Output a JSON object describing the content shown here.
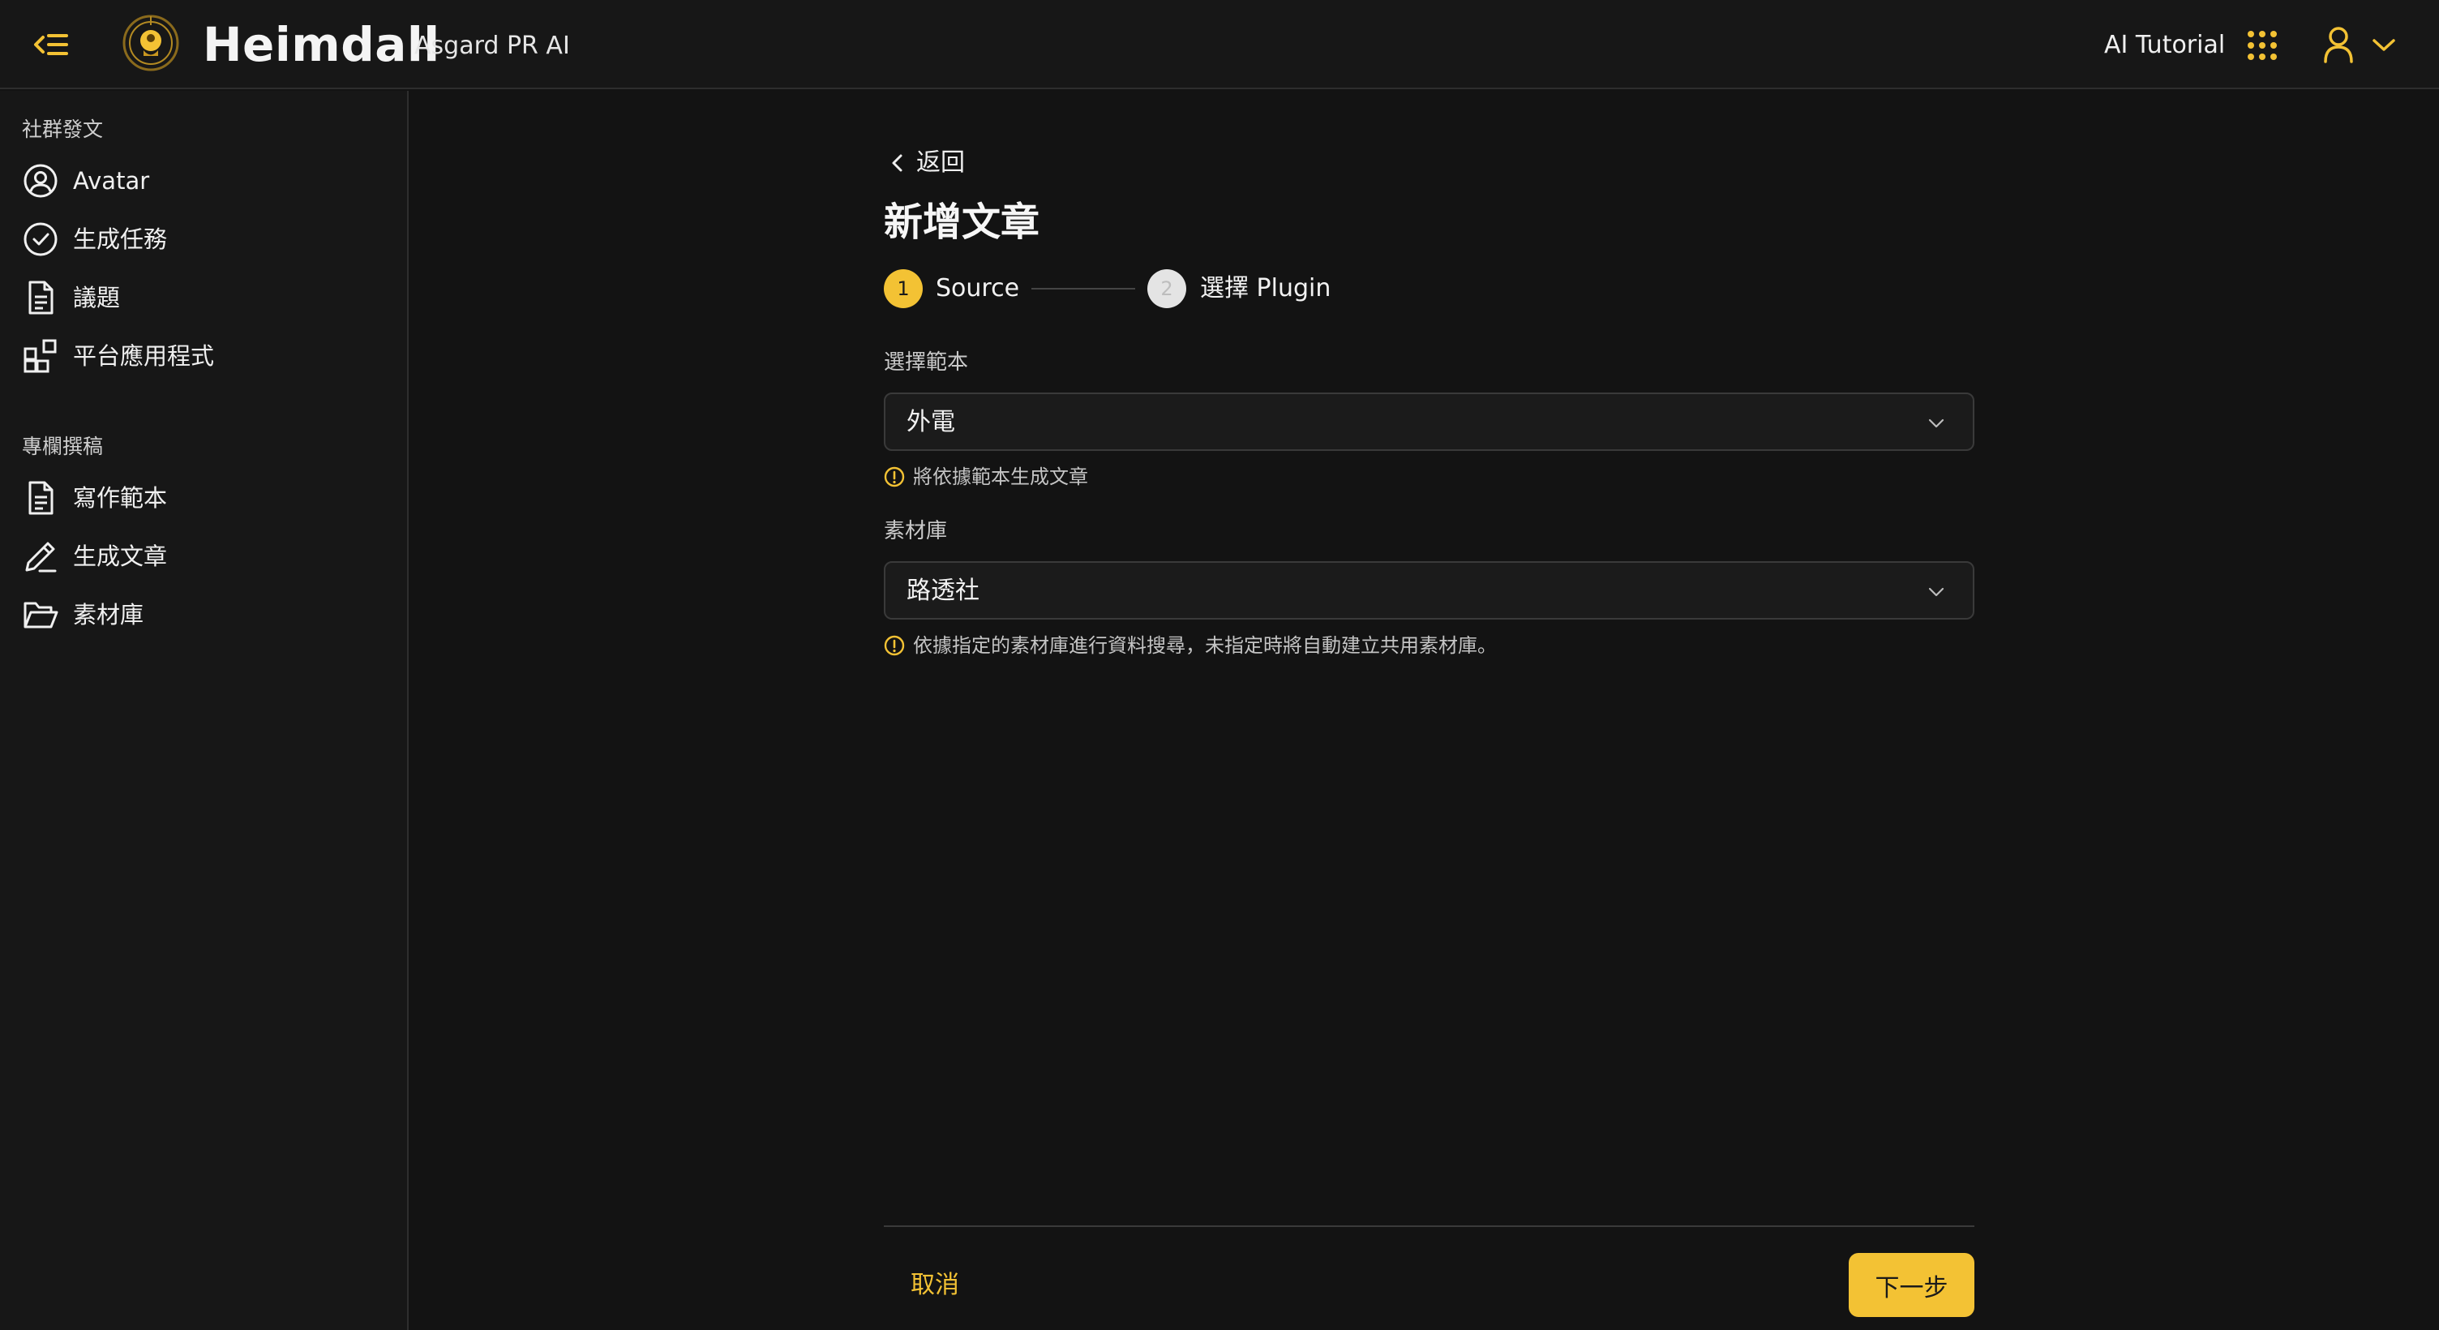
{
  "header": {
    "title": "Heimdall",
    "subtitle": "Asgard PR AI",
    "link": "AI Tutorial",
    "accent": "#f3c234"
  },
  "sidebar": {
    "sections": [
      {
        "title": "社群發文",
        "items": [
          {
            "label": "Avatar",
            "icon": "user-circle-icon"
          },
          {
            "label": "生成任務",
            "icon": "check-circle-icon"
          },
          {
            "label": "議題",
            "icon": "document-icon"
          },
          {
            "label": "平台應用程式",
            "icon": "apps-grid-icon"
          }
        ]
      },
      {
        "title": "專欄撰稿",
        "items": [
          {
            "label": "寫作範本",
            "icon": "document-icon"
          },
          {
            "label": "生成文章",
            "icon": "pen-icon"
          },
          {
            "label": "素材庫",
            "icon": "folder-open-icon"
          }
        ]
      }
    ]
  },
  "main": {
    "back_label": "返回",
    "title": "新增文章",
    "steps": [
      {
        "number": "1",
        "label": "Source",
        "active": true
      },
      {
        "number": "2",
        "label": "選擇 Plugin",
        "active": false
      }
    ],
    "fields": [
      {
        "label": "選擇範本",
        "value": "外電",
        "hint": "將依據範本生成文章"
      },
      {
        "label": "素材庫",
        "value": "路透社",
        "hint": "依據指定的素材庫進行資料搜尋，未指定時將自動建立共用素材庫。"
      }
    ],
    "cancel_label": "取消",
    "next_label": "下一步"
  }
}
